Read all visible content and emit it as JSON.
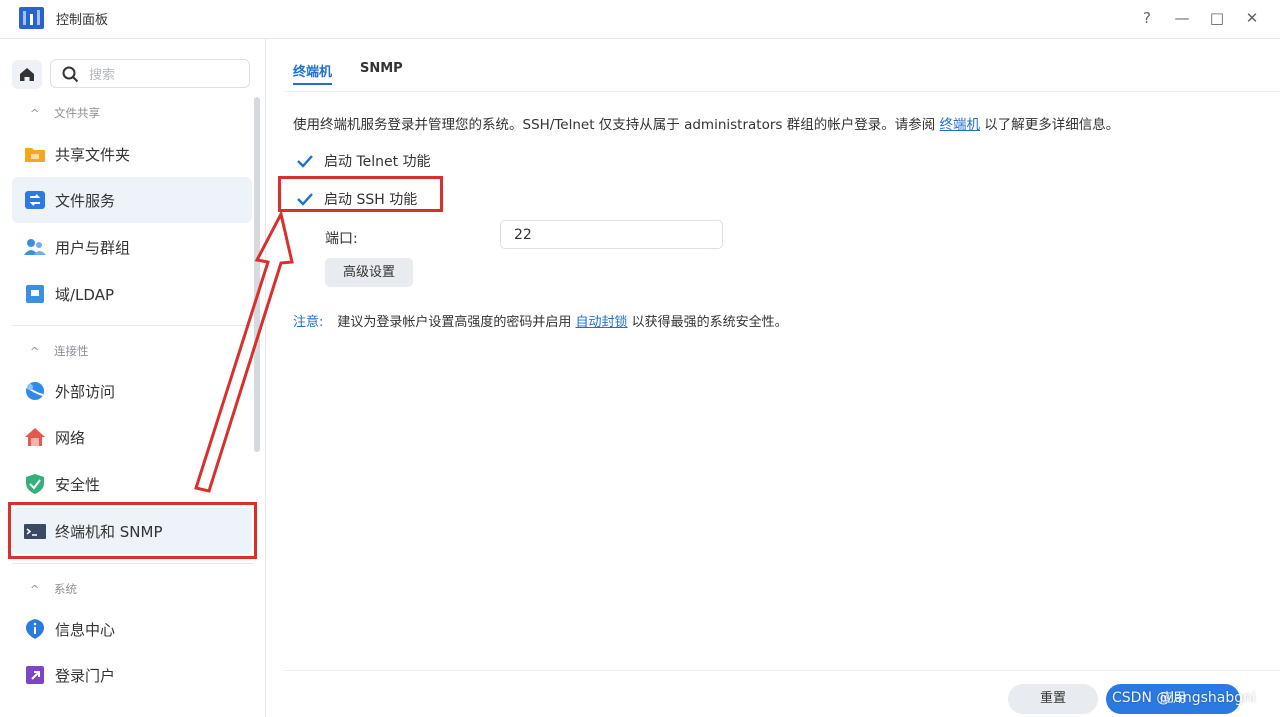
{
  "window": {
    "title": "控制面板",
    "controls": {
      "help": "?",
      "minimize": "—",
      "maximize": "□",
      "close": "✕"
    }
  },
  "sidebar": {
    "search_placeholder": "搜索",
    "sections": [
      {
        "title": "文件共享",
        "chevron": "^"
      },
      {
        "title": "连接性",
        "chevron": "^"
      },
      {
        "title": "系统",
        "chevron": "^"
      }
    ],
    "items": [
      {
        "label": "共享文件夹",
        "icon": "folder-icon",
        "color": "#f5a623"
      },
      {
        "label": "文件服务",
        "icon": "file-services-icon",
        "color": "#2a7ae2"
      },
      {
        "label": "用户与群组",
        "icon": "users-icon",
        "color": "#3b8fe0"
      },
      {
        "label": "域/LDAP",
        "icon": "domain-icon",
        "color": "#3b8fe0"
      },
      {
        "label": "外部访问",
        "icon": "globe-icon",
        "color": "#2f8be6"
      },
      {
        "label": "网络",
        "icon": "network-house-icon",
        "color": "#e45a4a"
      },
      {
        "label": "安全性",
        "icon": "shield-icon",
        "color": "#36b07a"
      },
      {
        "label": "终端机和 SNMP",
        "icon": "terminal-icon",
        "color": "#3a4a63"
      },
      {
        "label": "信息中心",
        "icon": "info-icon",
        "color": "#2a7ae2"
      },
      {
        "label": "登录门户",
        "icon": "login-portal-icon",
        "color": "#7b45c6"
      }
    ]
  },
  "main": {
    "tabs": [
      {
        "label": "终端机",
        "active": true
      },
      {
        "label": "SNMP",
        "active": false
      }
    ],
    "description_prefix": "使用终端机服务登录并管理您的系统。SSH/Telnet 仅支持从属于 administrators 群组的帐户登录。请参阅 ",
    "description_link": "终端机",
    "description_suffix": " 以了解更多详细信息。",
    "telnet_label": "启动 Telnet 功能",
    "telnet_checked": true,
    "ssh_label": "启动 SSH 功能",
    "ssh_checked": true,
    "port_label": "端口:",
    "port_value": "22",
    "advanced_button": "高级设置",
    "note_label": "注意:",
    "note_prefix": "建议为登录帐户设置高强度的密码并启用 ",
    "note_link": "自动封锁",
    "note_suffix": " 以获得最强的系统安全性。"
  },
  "footer": {
    "reset_button": "重置",
    "apply_button": "应用"
  },
  "watermark": "CSDN @langshabgni",
  "colors": {
    "accent": "#1f6fd1",
    "annotation_red": "#d9302c"
  }
}
